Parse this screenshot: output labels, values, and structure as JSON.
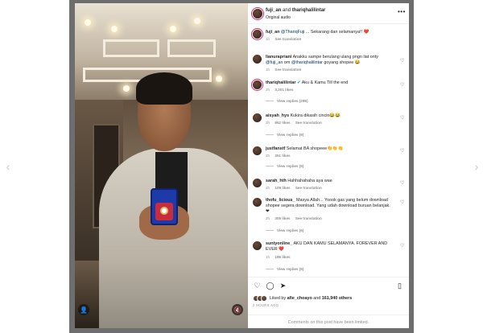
{
  "header": {
    "user1": "fuji_an",
    "joiner": "and",
    "user2": "thariqhalilintar",
    "audio": "Original audio",
    "more": "•••"
  },
  "comments": [
    {
      "username": "fuji_an",
      "text_mention": "@Thariq",
      "text_mention_2": "Fuji",
      "text": "... Sekarang dan selamanya!! ❤️",
      "time": "1h",
      "see_translation": "See translation"
    },
    {
      "username": "lianurapriani",
      "text": "Anakku sampe berulang ulang pngn liat onty",
      "text_line2_mention": "@fuji_an",
      "text_line2_mid": " om ",
      "text_line2_mention2": "@thariqhalilintar",
      "text_line2_end": " goyang shopee 😂",
      "time": "1h",
      "see_translation": "See translation"
    },
    {
      "username": "thariqhalilintar",
      "text": "Aku & Kamu Till the end",
      "time": "2h",
      "likes": "3,201 likes",
      "view_replies": "View replies (296)"
    },
    {
      "username": "aisyah_hys",
      "text": "Kukira dikasih cincin😂😂",
      "time": "2h",
      "likes": "852 likes",
      "see_translation": "See translation",
      "view_replies": "View replies (9)"
    },
    {
      "username": "justfanstf",
      "text": "Selamat BA shopeee👏👏👏",
      "time": "2h",
      "likes": "351 likes",
      "view_replies": "View replies (5)"
    },
    {
      "username": "sarah_hth",
      "text": "Hahhahahaha aya wae",
      "time": "2h",
      "likes": "109 likes",
      "see_translation": "See translation"
    },
    {
      "username": "thofu_licious_",
      "text": "Masya Allah... Yoook gas yang belum download shopee segera download. Yang udah download buruan belanjak. ❤",
      "time": "2h",
      "likes": "305 likes",
      "see_translation": "See translation",
      "view_replies": "View replies (6)"
    },
    {
      "username": "suntyonline_",
      "text": "AKU DAN KAMU SELAMANYA. FOREVER AND EVER ❤️",
      "time": "1h",
      "likes": "186 likes",
      "view_replies": "View replies (5)"
    }
  ],
  "actions": {
    "like_icon": "♡",
    "comment_icon": "◯",
    "share_icon": "➤",
    "save_icon": "▯"
  },
  "likes": {
    "prefix": "Liked by",
    "user": "afie_choayo",
    "joiner": "and",
    "count": "161,940 others"
  },
  "time_ago": "2 HOURS AGO",
  "comments_limited": "Comments on this post have been limited."
}
